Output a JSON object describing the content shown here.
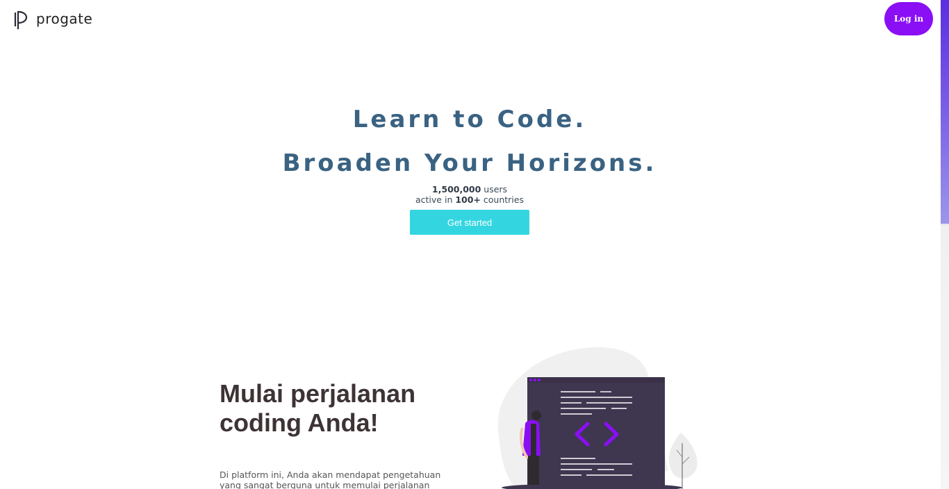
{
  "header": {
    "logo_text": "progate",
    "login_label": "Log in"
  },
  "hero": {
    "line1": "Learn to Code.",
    "line2": "Broaden Your Horizons.",
    "users_count": "1,500,000",
    "users_suffix": " users",
    "active_prefix": "active in ",
    "countries_count": "100+",
    "countries_suffix": " countries",
    "cta_label": "Get started"
  },
  "section": {
    "title": "Mulai perjalanan coding Anda!",
    "description": "Di platform ini, Anda akan mendapat pengetahuan yang sangat berguna untuk memulai perjalanan coding Anda kedepannya."
  },
  "colors": {
    "brand_purple": "#8a0ff5",
    "cta_cyan": "#33d6e0",
    "hero_text": "#3a6282"
  }
}
